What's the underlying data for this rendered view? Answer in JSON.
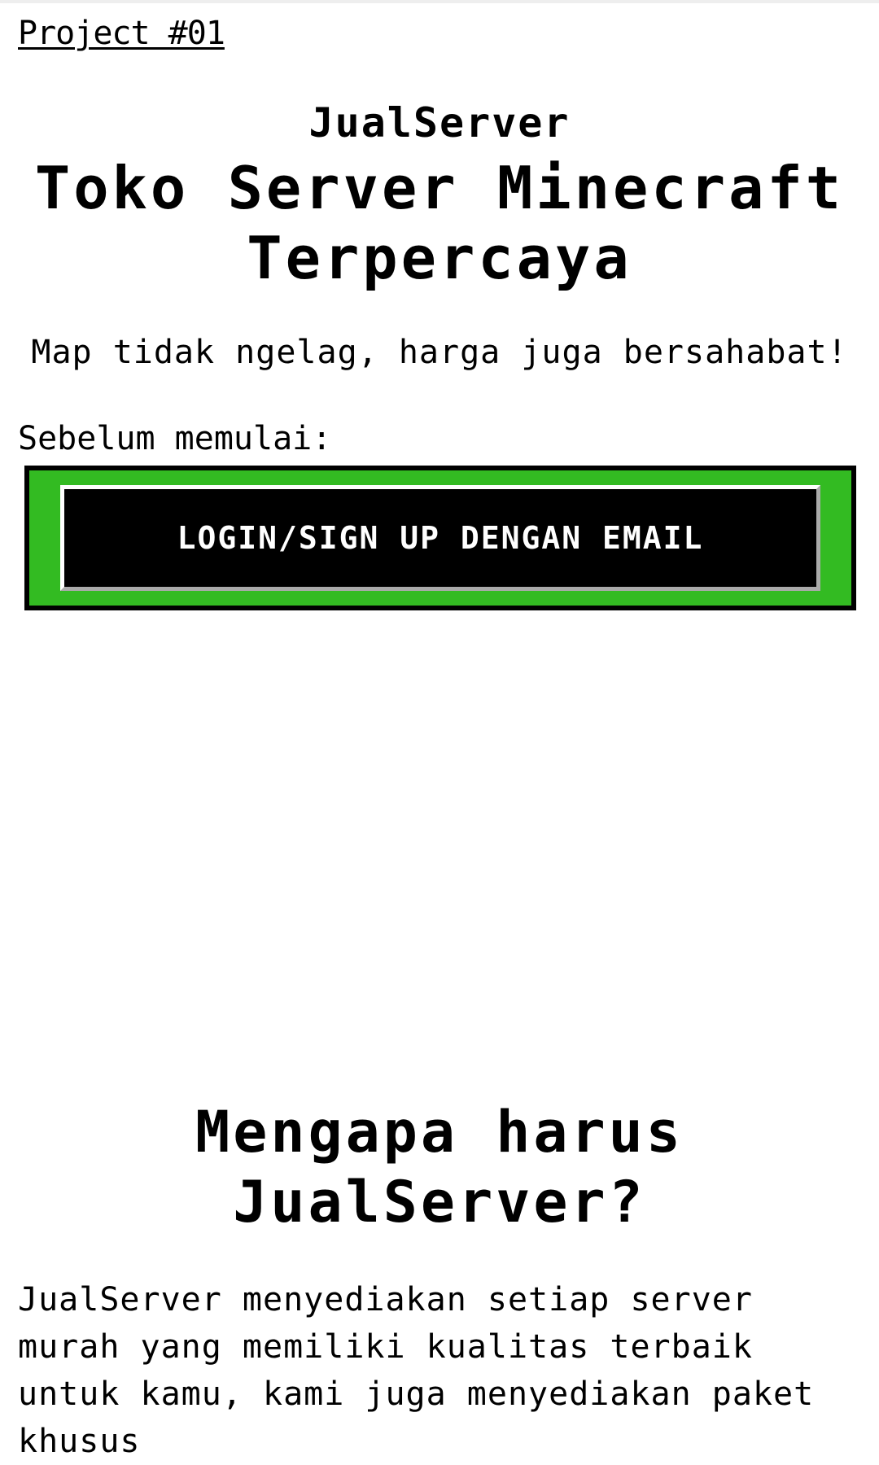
{
  "header": {
    "project_link": "Project #01"
  },
  "hero": {
    "brand": "JualServer",
    "headline": "Toko Server Minecraft Terpercaya",
    "tagline": "Map tidak ngelag, harga juga bersahabat!"
  },
  "login": {
    "before_label": "Sebelum memulai:",
    "button_label": "LOGIN/SIGN UP DENGAN EMAIL"
  },
  "why": {
    "heading": "Mengapa harus JualServer?",
    "body": "JualServer menyediakan setiap server murah yang memiliki kualitas terbaik untuk kamu, kami juga menyediakan paket khusus"
  },
  "colors": {
    "button_frame": "#33bb22",
    "button_bg": "#000000",
    "button_text": "#ffffff",
    "text": "#000000",
    "background": "#ffffff"
  }
}
